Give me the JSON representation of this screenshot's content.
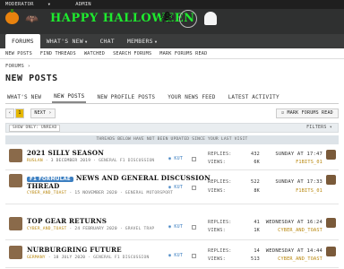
{
  "staff_bar": {
    "moderator": "MODERATOR",
    "admin": "ADMIN"
  },
  "nav": {
    "tabs": [
      {
        "label": "FORUMS"
      },
      {
        "label": "WHAT'S NEW"
      },
      {
        "label": "CHAT"
      },
      {
        "label": "MEMBERS"
      }
    ]
  },
  "subnav": {
    "items": [
      "NEW POSTS",
      "FIND THREADS",
      "WATCHED",
      "SEARCH FORUMS",
      "MARK FORUMS READ"
    ]
  },
  "breadcrumb": "FORUMS",
  "page_title": "NEW POSTS",
  "tabs": [
    "WHAT'S NEW",
    "NEW POSTS",
    "NEW PROFILE POSTS",
    "YOUR NEWS FEED",
    "LATEST ACTIVITY"
  ],
  "pagination": {
    "page": "1",
    "next": "NEXT ›"
  },
  "mark_read": "MARK FORUMS READ",
  "filter_chip": "SHOW ONLY: UNREAD",
  "filters_btn": "FILTERS ▾",
  "notice": "THREADS BELOW HAVE NOT BEEN UPDATED SINCE YOUR LAST VISIT",
  "threads": [
    {
      "title": "2021 SILLY SEASON",
      "prefix": "",
      "title2": "",
      "author": "RUSLAN",
      "date": "3 DECEMBER 2019",
      "forum": "GENERAL F1 DISCUSSION",
      "watch": "KUT",
      "replies_label": "REPLIES:",
      "replies": "432",
      "views_label": "VIEWS:",
      "views": "6K",
      "last_date": "SUNDAY AT 17:47",
      "last_user": "F1BITS_01"
    },
    {
      "title": "NEWS AND GENERAL DISCUSSION",
      "prefix": "F1 FORMULAE",
      "title2": "THREAD",
      "author": "CYBER_AND_TOAST",
      "date": "15 NOVEMBER 2020",
      "forum": "GENERAL MOTORSPORT",
      "watch": "KUT",
      "replies_label": "REPLIES:",
      "replies": "522",
      "views_label": "VIEWS:",
      "views": "8K",
      "last_date": "SUNDAY AT 17:33",
      "last_user": "F1BITS_01"
    },
    {
      "title": "TOP GEAR RETURNS",
      "prefix": "",
      "title2": "",
      "author": "CYBER_AND_TOAST",
      "date": "24 FEBRUARY 2020",
      "forum": "GRAVEL TRAP",
      "watch": "KUT",
      "replies_label": "REPLIES:",
      "replies": "41",
      "views_label": "VIEWS:",
      "views": "1K",
      "last_date": "WEDNESDAY AT 16:24",
      "last_user": "CYBER_AND_TOAST"
    },
    {
      "title": "NURBURGRING FUTURE",
      "prefix": "",
      "title2": "",
      "author": "GERMANY",
      "date": "18 JULY 2020",
      "forum": "GENERAL F1 DISCUSSION",
      "watch": "KUT",
      "replies_label": "REPLIES:",
      "replies": "14",
      "views_label": "VIEWS:",
      "views": "513",
      "last_date": "WEDNESDAY AT 14:44",
      "last_user": "CYBER_AND_TOAST"
    }
  ],
  "logo": {
    "text": "HAPPY HALLOWEEN"
  }
}
